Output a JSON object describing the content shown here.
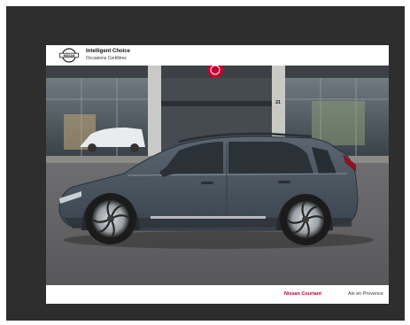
{
  "brand": {
    "logo_text": "NISSAN",
    "title": "Intelligent Choice",
    "subtitle": "Occasions Certifiées"
  },
  "photo": {
    "building_number": "21",
    "subject": "suv-side-view",
    "colors": {
      "car_body": "#4a5560",
      "showroom_sign": "#c3002f",
      "frame": "#2e2e2e"
    }
  },
  "footer": {
    "dealer_name": "Nissan Couriant",
    "city": "Aix en Provence"
  }
}
